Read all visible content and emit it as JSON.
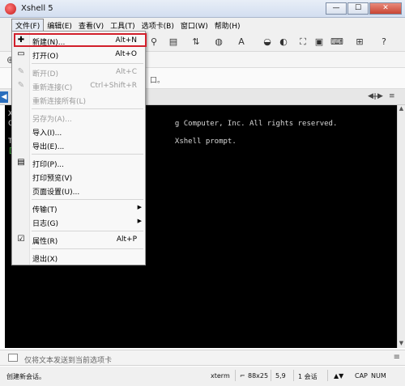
{
  "window": {
    "title": "Xshell 5",
    "minimize": "—",
    "maximize": "☐",
    "close": "✕"
  },
  "menubar": [
    {
      "label": "文件(F)"
    },
    {
      "label": "编辑(E)"
    },
    {
      "label": "查看(V)"
    },
    {
      "label": "工具(T)"
    },
    {
      "label": "选项卡(B)"
    },
    {
      "label": "窗口(W)"
    },
    {
      "label": "帮助(H)"
    }
  ],
  "tipbar": {
    "text": "口。"
  },
  "terminal": {
    "lines": [
      "X",
      "C                                     g Computer, Inc. All rights reserved.",
      "",
      "T                                     Xshell prompt.",
      "["
    ]
  },
  "compose": {
    "placeholder": "仅将文本发送到当前选项卡"
  },
  "status": {
    "message": "创建新会话。",
    "term": "xterm",
    "size": "88x25",
    "cursor": "5,9",
    "sessions": "1 会话",
    "caps": "CAP",
    "num": "NUM"
  },
  "file_menu": {
    "items": [
      {
        "label": "新建(N)...",
        "shortcut": "Alt+N"
      },
      {
        "label": "打开(O)",
        "shortcut": "Alt+O"
      },
      {
        "label": "断开(D)",
        "shortcut": "Alt+C"
      },
      {
        "label": "重新连接(C)",
        "shortcut": "Ctrl+Shift+R"
      },
      {
        "label": "重新连接所有(L)",
        "shortcut": ""
      },
      {
        "label": "另存为(A)...",
        "shortcut": ""
      },
      {
        "label": "导入(I)...",
        "shortcut": ""
      },
      {
        "label": "导出(E)...",
        "shortcut": ""
      },
      {
        "label": "打印(P)...",
        "shortcut": ""
      },
      {
        "label": "打印预览(V)",
        "shortcut": ""
      },
      {
        "label": "页面设置(U)...",
        "shortcut": ""
      },
      {
        "label": "传输(T)",
        "shortcut": ""
      },
      {
        "label": "日志(G)",
        "shortcut": ""
      },
      {
        "label": "属性(R)",
        "shortcut": "Alt+P"
      },
      {
        "label": "退出(X)",
        "shortcut": ""
      }
    ]
  },
  "colors": {
    "highlight_border": "#d21f2b",
    "terminal_bg": "#000000",
    "tab_accent": "#2a6ebd"
  }
}
